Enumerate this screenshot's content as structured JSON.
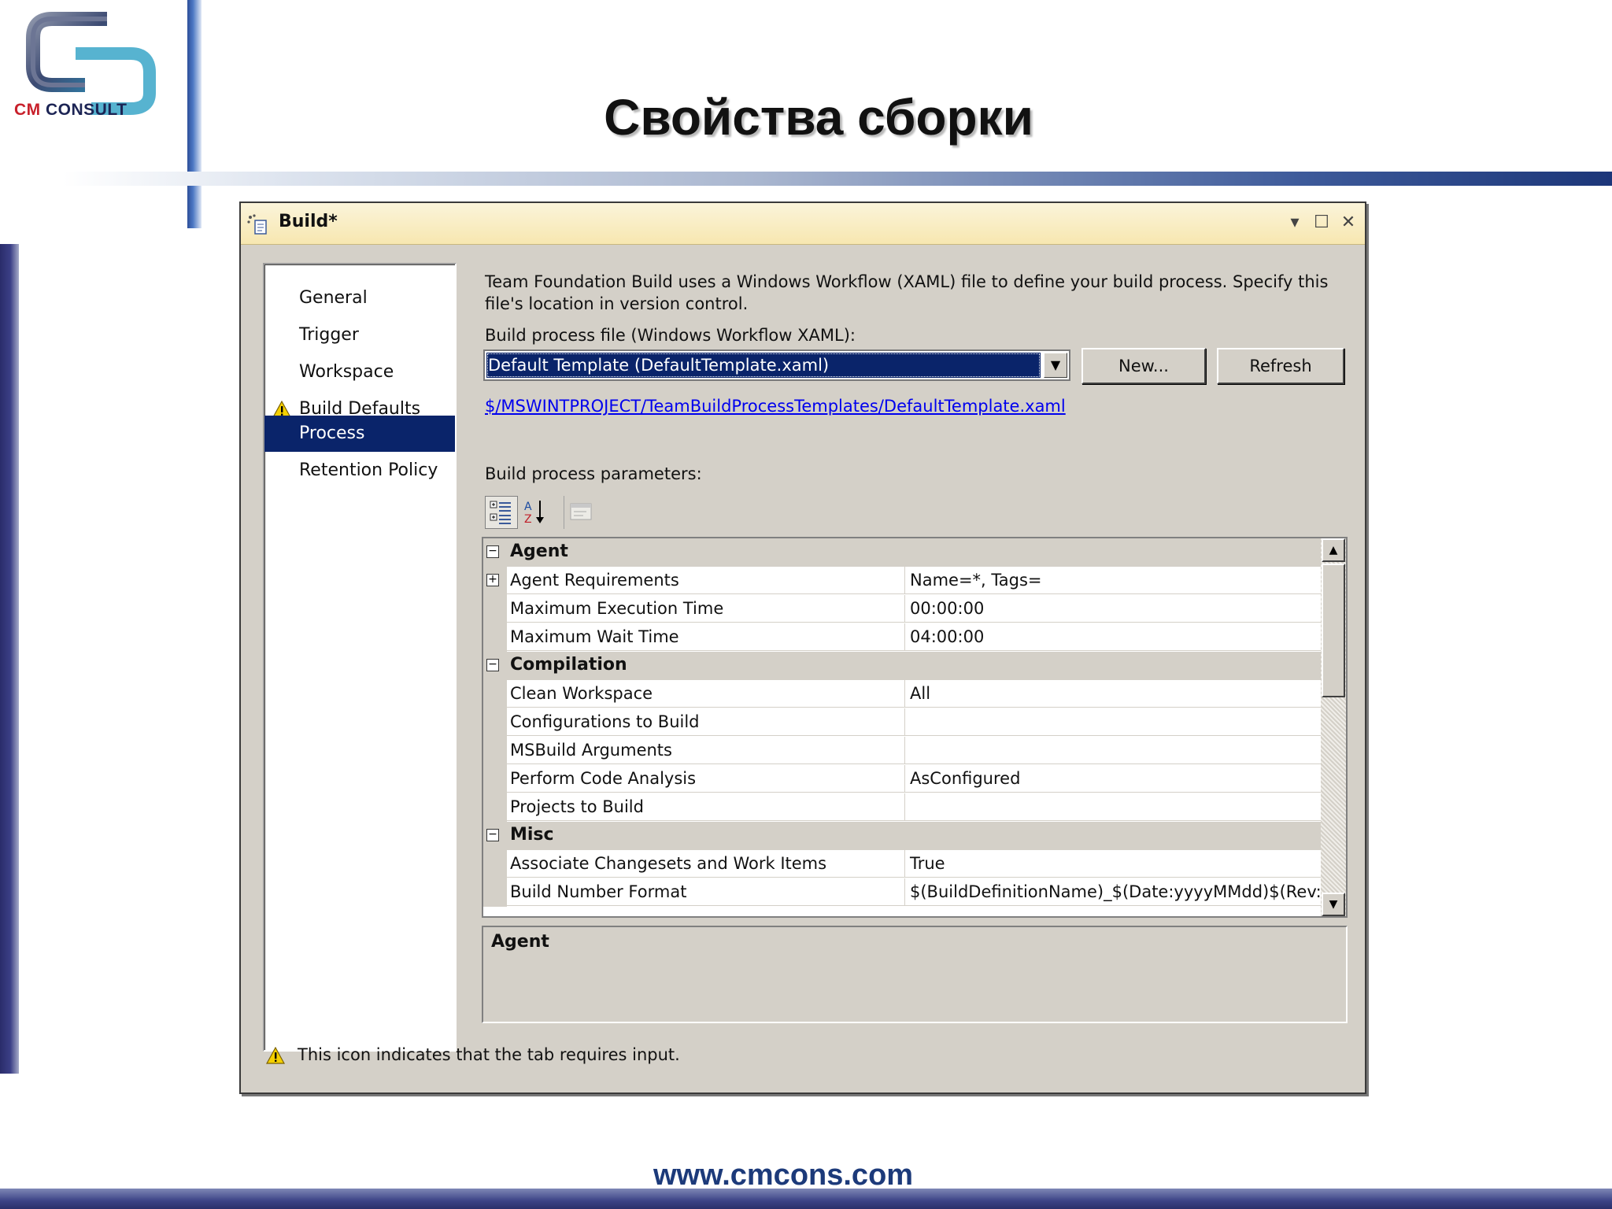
{
  "slide": {
    "logo_prefix": "CM",
    "logo_suffix": " CONSULT",
    "title": "Свойства сборки",
    "footer_url": "www.cmcons.com"
  },
  "window": {
    "title": "Build*",
    "controls": {
      "menu": "▾",
      "maximize": "☐",
      "close": "✕"
    }
  },
  "nav": {
    "items": [
      {
        "label": "General",
        "warning": false,
        "selected": false
      },
      {
        "label": "Trigger",
        "warning": false,
        "selected": false
      },
      {
        "label": "Workspace",
        "warning": false,
        "selected": false
      },
      {
        "label": "Build Defaults",
        "warning": true,
        "selected": false
      },
      {
        "label": "Process",
        "warning": false,
        "selected": true
      },
      {
        "label": "Retention Policy",
        "warning": false,
        "selected": false
      }
    ]
  },
  "process": {
    "description_line1": "Team Foundation Build uses a Windows Workflow (XAML) file to define your build process. Specify this",
    "description_line2": "file's location in version control.",
    "file_label": "Build process file (Windows Workflow XAML):",
    "file_value": "Default Template (DefaultTemplate.xaml)",
    "new_button": "New...",
    "refresh_button": "Refresh",
    "path": "$/MSWINTPROJECT/TeamBuildProcessTemplates/DefaultTemplate.xaml",
    "params_label": "Build process parameters:"
  },
  "grid": {
    "rows": [
      {
        "type": "cat",
        "name": "Agent"
      },
      {
        "type": "prop",
        "name": "Agent Requirements",
        "value": "Name=*, Tags=",
        "expandable": true
      },
      {
        "type": "prop",
        "name": "Maximum Execution Time",
        "value": "00:00:00"
      },
      {
        "type": "prop",
        "name": "Maximum Wait Time",
        "value": "04:00:00"
      },
      {
        "type": "cat",
        "name": "Compilation"
      },
      {
        "type": "prop",
        "name": "Clean Workspace",
        "value": "All"
      },
      {
        "type": "prop",
        "name": "Configurations to Build",
        "value": ""
      },
      {
        "type": "prop",
        "name": "MSBuild Arguments",
        "value": ""
      },
      {
        "type": "prop",
        "name": "Perform Code Analysis",
        "value": "AsConfigured"
      },
      {
        "type": "prop",
        "name": "Projects to Build",
        "value": ""
      },
      {
        "type": "cat",
        "name": "Misc"
      },
      {
        "type": "prop",
        "name": "Associate Changesets and Work Items",
        "value": "True"
      },
      {
        "type": "prop",
        "name": "Build Number Format",
        "value": "$(BuildDefinitionName)_$(Date:yyyyMMdd)$(Rev:.r)"
      }
    ],
    "help_title": "Agent"
  },
  "status": {
    "text": "This icon indicates that the tab requires input."
  },
  "colors": {
    "selection": "#0a246a",
    "window_bg": "#d4d0c8",
    "titlebar": "#f7e7b0",
    "link": "#0000ee"
  }
}
